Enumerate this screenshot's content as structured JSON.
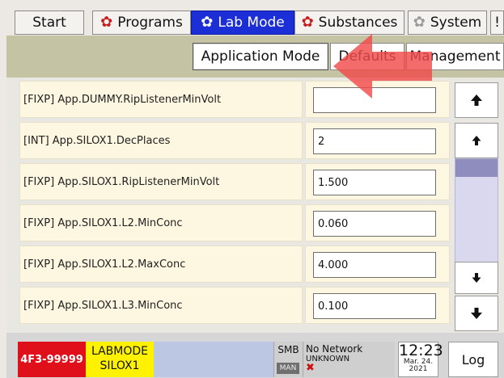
{
  "tabs": [
    {
      "label": "Start",
      "icon": null
    },
    {
      "label": "Programs",
      "icon": "gear-icon"
    },
    {
      "label": "Lab Mode",
      "icon": "gear-icon",
      "active": true
    },
    {
      "label": "Substances",
      "icon": "gear-icon"
    },
    {
      "label": "System",
      "icon": "gear-icon"
    },
    {
      "label": "!"
    }
  ],
  "subtabs": [
    {
      "label": "Application Mode",
      "active": true
    },
    {
      "label": "Defaults"
    },
    {
      "label": "Management"
    }
  ],
  "parameters": [
    {
      "label": "[FIXP] App.DUMMY.RipListenerMinVolt",
      "value": ""
    },
    {
      "label": "[INT] App.SILOX1.DecPlaces",
      "value": "2"
    },
    {
      "label": "[FIXP] App.SILOX1.RipListenerMinVolt",
      "value": "1.500"
    },
    {
      "label": "[FIXP] App.SILOX1.L2.MinConc",
      "value": "0.060"
    },
    {
      "label": "[FIXP] App.SILOX1.L2.MaxConc",
      "value": "4.000"
    },
    {
      "label": "[FIXP] App.SILOX1.L3.MinConc",
      "value": "0.100"
    }
  ],
  "scroll": {
    "page_up_icon": "arrow-up-bold-icon",
    "line_up_icon": "arrow-up-icon",
    "line_down_icon": "arrow-down-icon",
    "page_down_icon": "arrow-down-bold-icon",
    "position": 0.0
  },
  "status": {
    "device_id": "4F3-99999",
    "mode_line1": "LABMODE",
    "mode_line2": "SILOX1",
    "smb_label": "SMB",
    "man_label": "MAN",
    "network_line1": "No Network",
    "network_line2": "UNKNOWN",
    "network_error_icon": "x-mark-icon",
    "time": "12:23",
    "date_line1": "Mar. 24.",
    "date_line2": "2021",
    "log_label": "Log"
  },
  "colors": {
    "active_tab": "#1c2fd6",
    "gear_red": "#c81d1d",
    "subtab_bar": "#c4c3a3",
    "row_bg": "#fdf6e0",
    "device_red": "#e0101a",
    "mode_yellow": "#fff200",
    "scroll_thumb": "#8e8dbd",
    "overlay_arrow": "#f04a4a"
  }
}
